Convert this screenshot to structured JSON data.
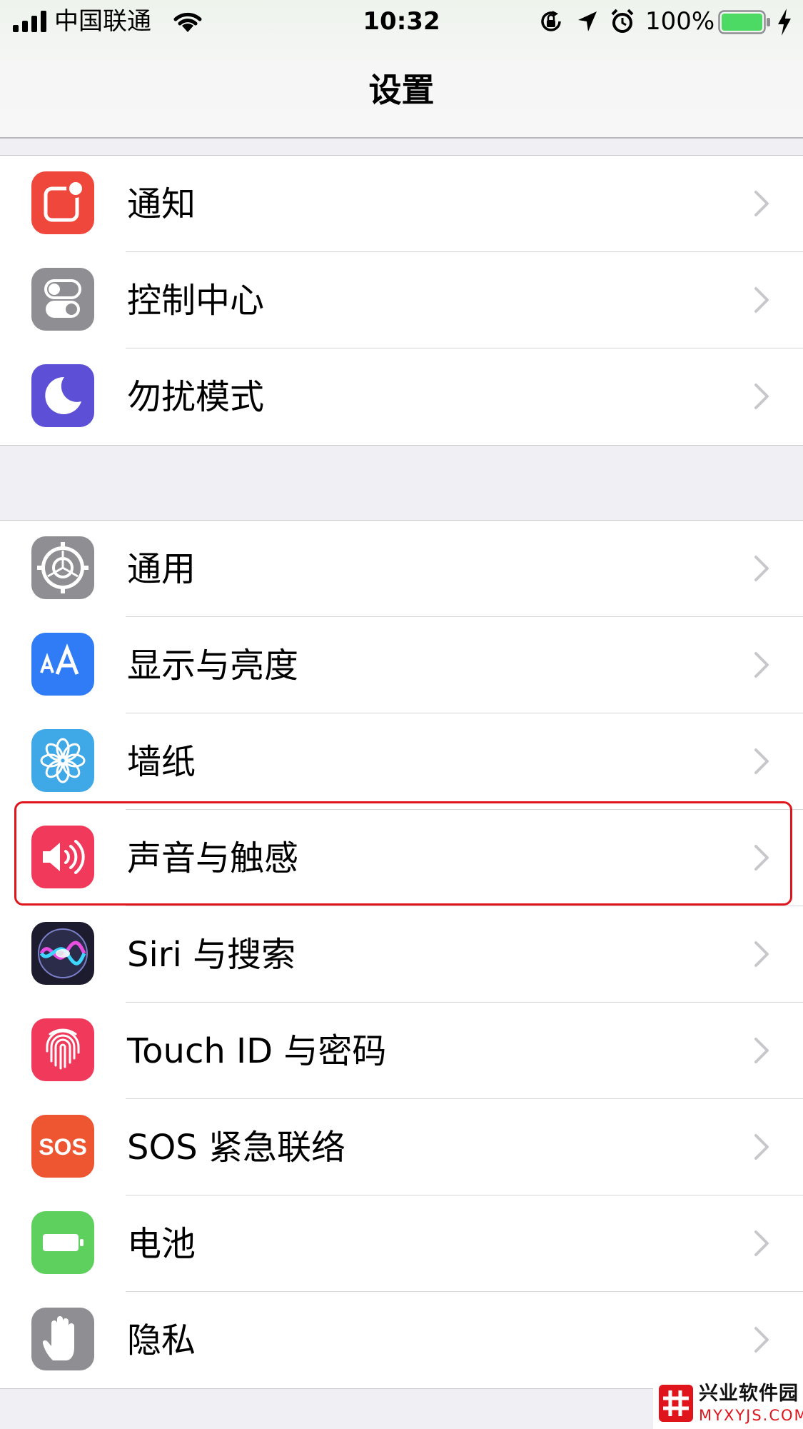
{
  "status_bar": {
    "carrier": "中国联通",
    "time": "10:32",
    "battery_percent": "100%",
    "battery_color": "#4cd964",
    "icons": [
      "signal-icon",
      "wifi-icon",
      "orientation-lock-icon",
      "location-icon",
      "alarm-icon",
      "battery-icon",
      "charging-bolt-icon"
    ]
  },
  "nav": {
    "title": "设置"
  },
  "groups": [
    {
      "items": [
        {
          "label": "通知",
          "icon": "notifications-icon",
          "icon_color": "#f0473c"
        },
        {
          "label": "控制中心",
          "icon": "control-center-icon",
          "icon_color": "#8e8e93"
        },
        {
          "label": "勿扰模式",
          "icon": "moon-icon",
          "icon_color": "#5d50d6"
        }
      ]
    },
    {
      "items": [
        {
          "label": "通用",
          "icon": "gear-icon",
          "icon_color": "#8e8e93"
        },
        {
          "label": "显示与亮度",
          "icon": "display-text-size-icon",
          "icon_color": "#2f7cf6"
        },
        {
          "label": "墙纸",
          "icon": "wallpaper-flower-icon",
          "icon_color": "#3fa8e6"
        },
        {
          "label": "声音与触感",
          "icon": "speaker-icon",
          "icon_color": "#f0395b",
          "highlighted": true
        },
        {
          "label": "Siri 与搜索",
          "icon": "siri-icon",
          "icon_color": "#1c1c2e"
        },
        {
          "label": "Touch ID 与密码",
          "icon": "fingerprint-icon",
          "icon_color": "#f0395b"
        },
        {
          "label": "SOS 紧急联络",
          "icon": "sos-icon",
          "icon_color": "#ee5631",
          "icon_text": "SOS"
        },
        {
          "label": "电池",
          "icon": "battery-icon",
          "icon_color": "#5ed05e"
        },
        {
          "label": "隐私",
          "icon": "hand-icon",
          "icon_color": "#8e8e93"
        }
      ]
    }
  ],
  "highlight_color": "#e0141b",
  "watermark": {
    "name": "兴业软件园",
    "url": "MYXYJS.COM"
  }
}
